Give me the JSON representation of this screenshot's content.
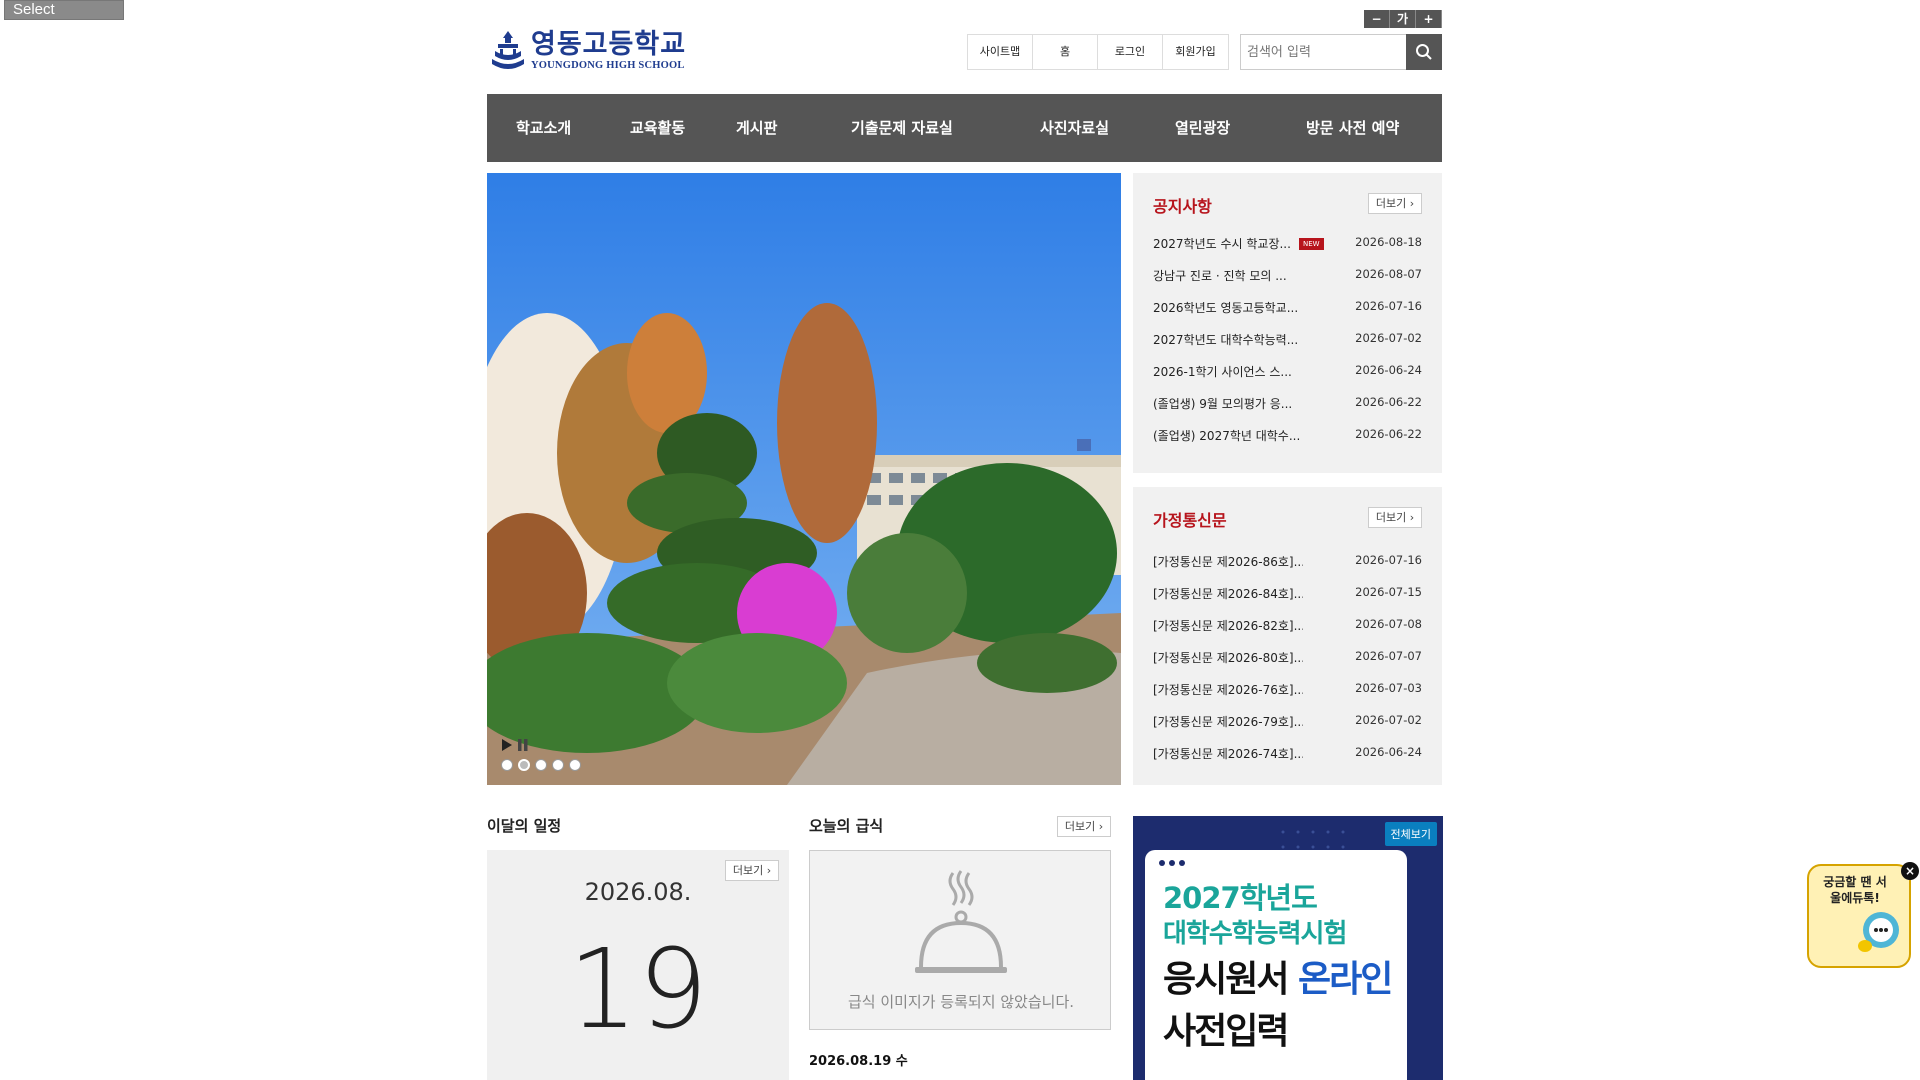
{
  "language_button": "Select Language",
  "font_controls": [
    "−",
    "가",
    "+"
  ],
  "logo": {
    "kor": "영동고등학교",
    "eng": "YOUNGDONG HIGH SCHOOL"
  },
  "util_links": [
    "사이트맵",
    "홈",
    "로그인",
    "회원가입"
  ],
  "search": {
    "placeholder": "검색어 입력"
  },
  "nav": [
    "학교소개",
    "교육활동",
    "게시판",
    "기출문제 자료실",
    "사진자료실",
    "열린광장",
    "방문 사전 예약"
  ],
  "notice": {
    "title": "공지사항",
    "more": "더보기",
    "new_badge": "NEW",
    "items": [
      {
        "title": "2027학년도 수시 학교장...",
        "date": "2026-08-18"
      },
      {
        "title": "강남구 진로 · 진학 모의 ...",
        "date": "2026-08-07"
      },
      {
        "title": "2026학년도 영동고등학교...",
        "date": "2026-07-16"
      },
      {
        "title": "2027학년도 대학수학능력...",
        "date": "2026-07-02"
      },
      {
        "title": "2026-1학기 사이언스 스...",
        "date": "2026-06-24"
      },
      {
        "title": "(졸업생) 9월 모의평가 응...",
        "date": "2026-06-22"
      },
      {
        "title": "(졸업생) 2027학년 대학수...",
        "date": "2026-06-22"
      }
    ]
  },
  "newsletter": {
    "title": "가정통신문",
    "more": "더보기",
    "items": [
      {
        "title": "[가정통신문 제2026-86호]...",
        "date": "2026-07-16"
      },
      {
        "title": "[가정통신문 제2026-84호]...",
        "date": "2026-07-15"
      },
      {
        "title": "[가정통신문 제2026-82호]...",
        "date": "2026-07-08"
      },
      {
        "title": "[가정통신문 제2026-80호]...",
        "date": "2026-07-07"
      },
      {
        "title": "[가정통신문 제2026-76호]...",
        "date": "2026-07-03"
      },
      {
        "title": "[가정통신문 제2026-79호]...",
        "date": "2026-07-02"
      },
      {
        "title": "[가정통신문 제2026-74호]...",
        "date": "2026-06-24"
      }
    ]
  },
  "schedule": {
    "title": "이달의 일정",
    "more": "더보기",
    "month": "2026.08.",
    "day": "19"
  },
  "meal": {
    "title": "오늘의 급식",
    "more": "더보기",
    "no_image": "급식 이미지가 등록되지 않았습니다.",
    "date": "2026.08.19 수"
  },
  "banner": {
    "view_all": "전체보기",
    "line1": "2027학년도",
    "line2": "대학수학능력시험",
    "line3a": "응시원서 ",
    "line3b": "온라인",
    "line4": "사전입력"
  },
  "floating": {
    "text": "궁금할 땐 서울에듀톡!"
  },
  "colors": {
    "nav_bg": "#555555",
    "accent_red": "#b7141c",
    "brand_blue": "#1f3c8f",
    "banner_navy": "#1d2c6e",
    "banner_teal": "#1aa59a"
  }
}
